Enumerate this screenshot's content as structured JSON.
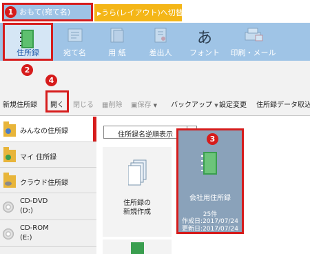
{
  "tabs": {
    "front": "おもて(宛て名)",
    "back": "うら(レイアウト)へ切替"
  },
  "ribbon": [
    {
      "label": "住所録",
      "icon": "address-book-icon",
      "selected": true
    },
    {
      "label": "宛て名",
      "icon": "addressee-icon"
    },
    {
      "label": "用 紙",
      "icon": "paper-icon"
    },
    {
      "label": "差出人",
      "icon": "sender-icon"
    },
    {
      "label": "フォント",
      "icon": "font-icon",
      "glyph": "あ"
    },
    {
      "label": "印刷・メール",
      "icon": "print-mail-icon"
    }
  ],
  "toolbar": {
    "new": "新規住所録",
    "open": "開く",
    "close": "閉じる",
    "delete": "削除",
    "save": "保存",
    "backup": "バックアップ",
    "settings": "設定変更",
    "import": "住所録データ取込"
  },
  "sidebar": [
    {
      "label": "みんなの住所録",
      "active": true
    },
    {
      "label": "マイ 住所録"
    },
    {
      "label": "クラウド住所録"
    },
    {
      "label": "CD-DVD",
      "sub": "(D:)"
    },
    {
      "label": "CD-ROM",
      "sub": "(E:)"
    }
  ],
  "sort": {
    "value": "住所録名逆順表示"
  },
  "cards": {
    "new_line1": "住所録の",
    "new_line2": "新規作成",
    "company": {
      "name": "会社用住所録",
      "count": "25件",
      "created": "作成日:2017/07/24",
      "updated": "更新日:2017/07/24"
    }
  },
  "markers": [
    "1",
    "2",
    "3",
    "4"
  ],
  "colors": {
    "accent_red": "#d61c1c",
    "ribbon_blue": "#9fc4e6",
    "tab_orange": "#f4b617"
  }
}
